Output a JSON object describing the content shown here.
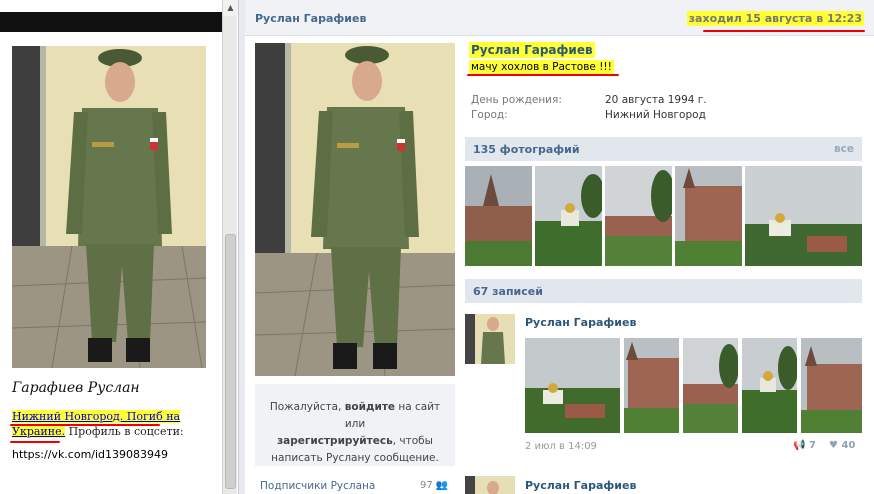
{
  "left_panel": {
    "caption": "Гарафиев Руслан",
    "highlight_text": "Нижний Новгород. Погиб на Украине.",
    "plain_text": "Профиль в соцсети:",
    "url": "https://vk.com/id139083949"
  },
  "profile": {
    "header_name": "Руслан Гарафиев",
    "last_seen": "заходил 15 августа в 12:23",
    "full_name": "Руслан Гарафиев",
    "status": "мачу хохлов в Растове !!!",
    "info": [
      {
        "label": "День рождения:",
        "value": "20 августа 1994 г."
      },
      {
        "label": "Город:",
        "value": "Нижний Новгород"
      }
    ],
    "message_box": {
      "line1_pre": "Пожалуйста, ",
      "line1_bold": "войдите",
      "line1_post": " на сайт или",
      "line2_bold": "зарегистрируйтесь",
      "line2_post": ", чтобы",
      "line3": "написать Руслану сообщение."
    },
    "subscribers_label": "Подписчики Руслана",
    "subscribers_count": "97"
  },
  "photos": {
    "label": "135 фотографий",
    "all_link": "все"
  },
  "wall": {
    "label": "67 записей",
    "posts": [
      {
        "author": "Руслан Гарафиев",
        "date": "2 июл в 14:09",
        "reposts": "7",
        "likes": "40"
      },
      {
        "author": "Руслан Гарафиев"
      }
    ]
  },
  "colors": {
    "highlight": "#ffff33",
    "vk_link": "#2b587a",
    "vk_bar": "#e1e7ed",
    "underline": "#ee0000"
  }
}
